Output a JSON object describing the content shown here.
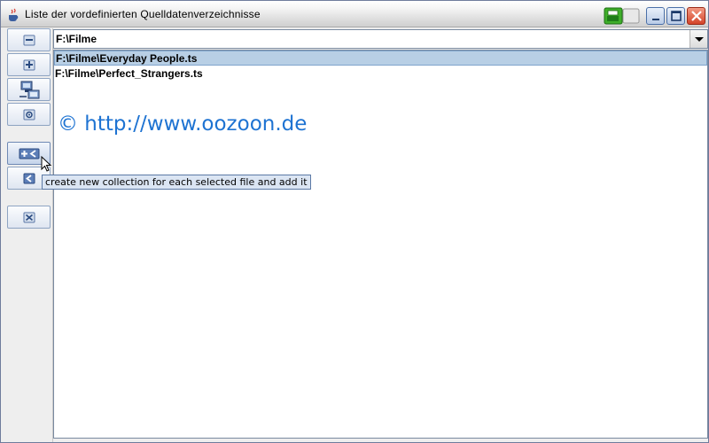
{
  "window": {
    "title": "Liste der vordefinierten Quelldatenverzeichnisse",
    "icons": {
      "app": "java-cup-icon",
      "tray": "green-printer-icon"
    },
    "controls": {
      "minimize": "minimize-icon",
      "maximize": "maximize-icon",
      "close": "close-icon"
    }
  },
  "sidebar": {
    "buttons": [
      {
        "name": "remove-dir-button",
        "icon": "minus-icon"
      },
      {
        "name": "add-dir-button",
        "icon": "plus-icon"
      },
      {
        "name": "network-dir-button",
        "icon": "network-computer-icon"
      },
      {
        "name": "refresh-button",
        "icon": "refresh-icon"
      },
      {
        "name": "add-collection-button",
        "icon": "plus-arrow-left-icon"
      },
      {
        "name": "add-to-collection-button",
        "icon": "arrow-left-icon"
      },
      {
        "name": "close-list-button",
        "icon": "x-icon"
      }
    ]
  },
  "combo": {
    "value": "F:\\Filme"
  },
  "list": {
    "items": [
      {
        "label": "F:\\Filme\\Everyday People.ts",
        "selected": true
      },
      {
        "label": "F:\\Filme\\Perfect_Strangers.ts",
        "selected": false
      }
    ],
    "watermark": "© http://www.oozoon.de"
  },
  "tooltip": {
    "text": "create new collection for each selected file and add it"
  },
  "colors": {
    "selection": "#b8cfe5",
    "watermark": "#1e73d2",
    "close": "#d4442a"
  }
}
